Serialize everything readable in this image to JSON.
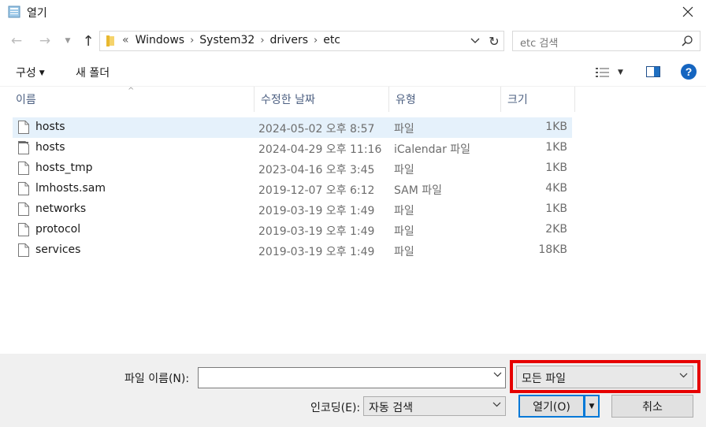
{
  "window": {
    "title": "열기"
  },
  "nav": {
    "breadcrumbs": [
      "Windows",
      "System32",
      "drivers",
      "etc"
    ],
    "overflow": "«"
  },
  "search": {
    "placeholder": "etc 검색"
  },
  "toolbar": {
    "organize_label": "구성",
    "new_folder_label": "새 폴더",
    "help_label": "?"
  },
  "columns": {
    "name": "이름",
    "date": "수정한 날짜",
    "type": "유형",
    "size": "크기"
  },
  "files": [
    {
      "name": "hosts",
      "date": "2024-05-02 오후 8:57",
      "type": "파일",
      "size": "1KB",
      "selected": true,
      "icon": "file-icon"
    },
    {
      "name": "hosts",
      "date": "2024-04-29 오후 11:16",
      "type": "iCalendar 파일",
      "size": "1KB",
      "selected": false,
      "icon": "calendar-file-icon"
    },
    {
      "name": "hosts_tmp",
      "date": "2023-04-16 오후 3:45",
      "type": "파일",
      "size": "1KB",
      "selected": false,
      "icon": "file-icon"
    },
    {
      "name": "lmhosts.sam",
      "date": "2019-12-07 오후 6:12",
      "type": "SAM 파일",
      "size": "4KB",
      "selected": false,
      "icon": "file-icon"
    },
    {
      "name": "networks",
      "date": "2019-03-19 오후 1:49",
      "type": "파일",
      "size": "1KB",
      "selected": false,
      "icon": "file-icon"
    },
    {
      "name": "protocol",
      "date": "2019-03-19 오후 1:49",
      "type": "파일",
      "size": "2KB",
      "selected": false,
      "icon": "file-icon"
    },
    {
      "name": "services",
      "date": "2019-03-19 오후 1:49",
      "type": "파일",
      "size": "18KB",
      "selected": false,
      "icon": "file-icon"
    }
  ],
  "bottom": {
    "filename_label": "파일 이름(N):",
    "filename_value": "",
    "filter_value": "모든 파일",
    "encoding_label": "인코딩(E):",
    "encoding_value": "자동 검색",
    "open_label": "열기(O)",
    "cancel_label": "취소"
  },
  "colors": {
    "accent": "#0078d7",
    "highlight": "#e60000",
    "selected_row": "#e5f1fb"
  }
}
